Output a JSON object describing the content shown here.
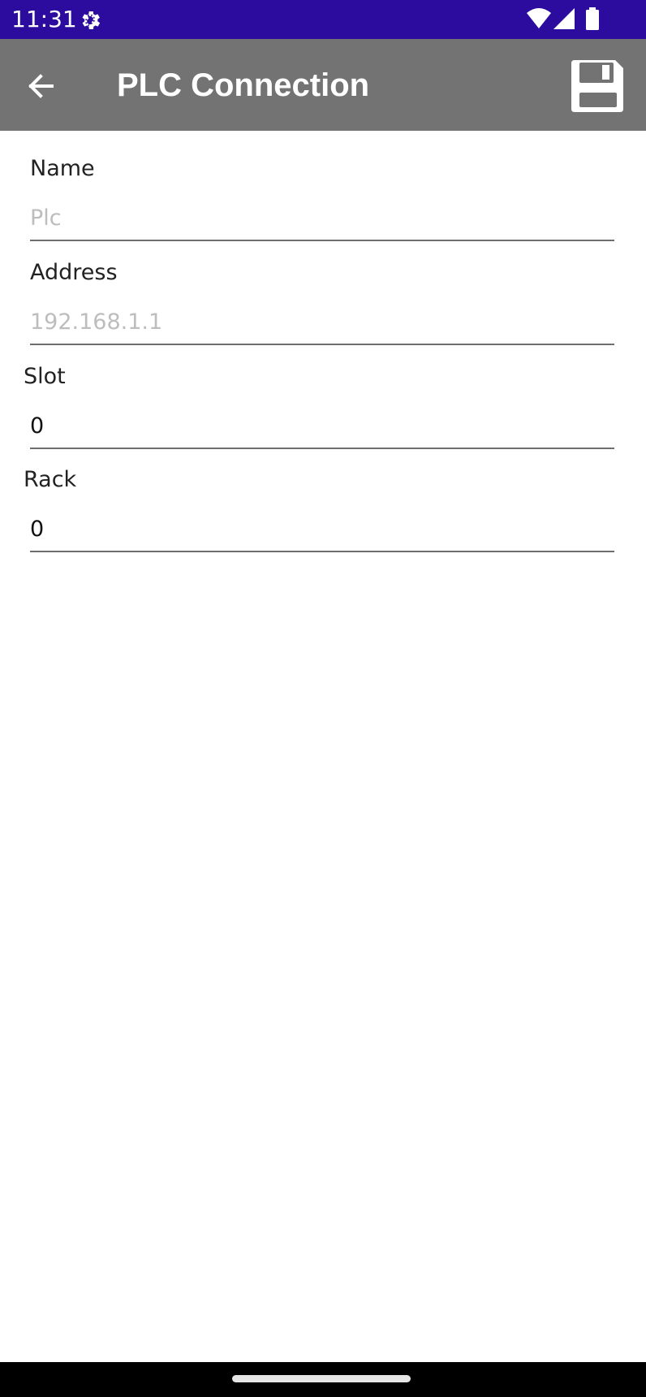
{
  "status_bar": {
    "time": "11:31",
    "icons": [
      "gear-icon",
      "wifi-icon",
      "signal-icon",
      "battery-icon"
    ],
    "background": "#2b0c9e"
  },
  "app_bar": {
    "title": "PLC Connection",
    "back_icon": "arrow-left-icon",
    "save_icon": "floppy-disk-icon",
    "background": "#737373"
  },
  "form": {
    "name": {
      "label": "Name",
      "value": "",
      "placeholder": "Plc"
    },
    "address": {
      "label": "Address",
      "value": "",
      "placeholder": "192.168.1.1"
    },
    "slot": {
      "label": "Slot",
      "value": "0",
      "placeholder": ""
    },
    "rack": {
      "label": "Rack",
      "value": "0",
      "placeholder": ""
    }
  }
}
